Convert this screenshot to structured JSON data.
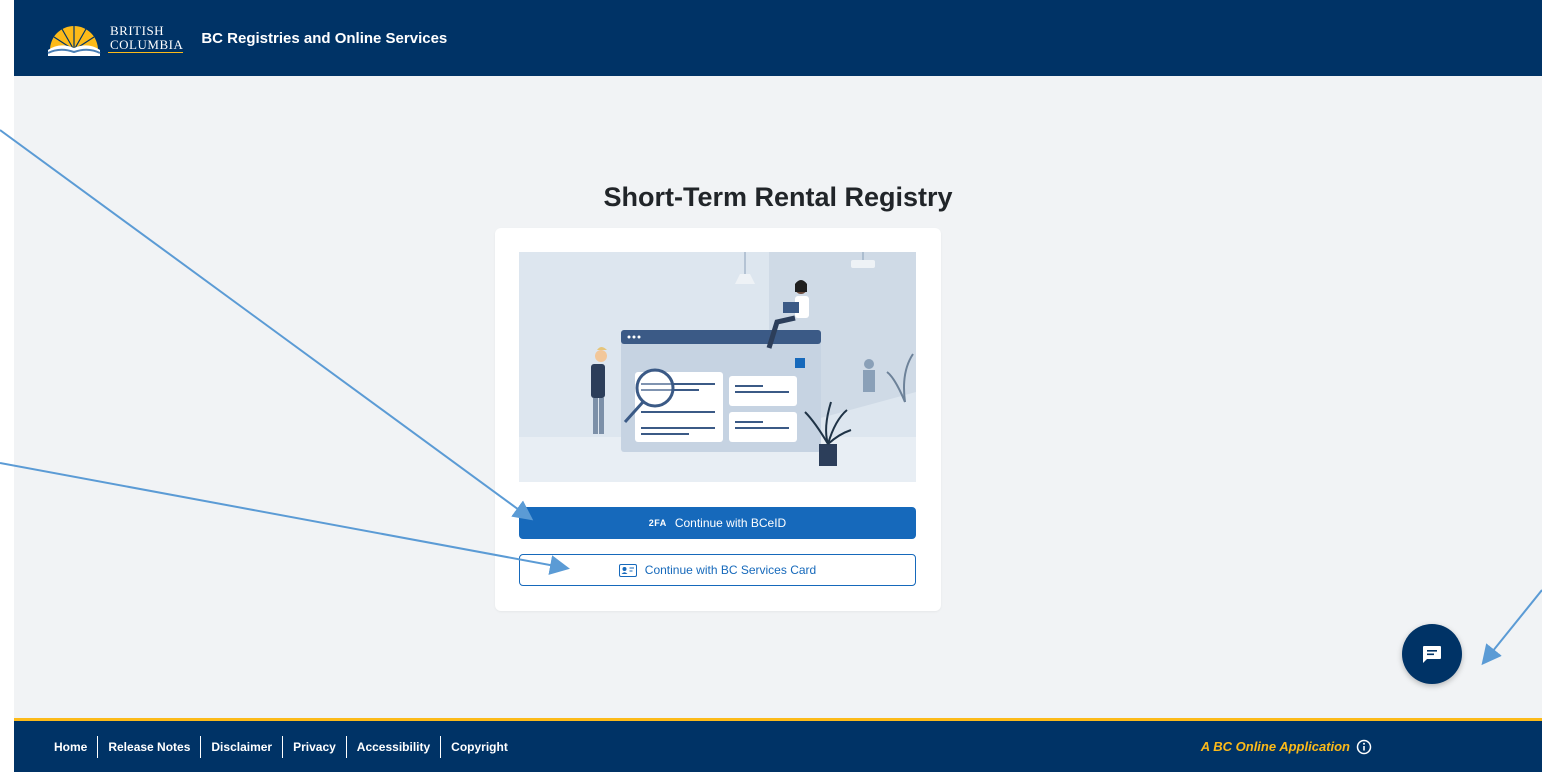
{
  "header": {
    "logo_line1": "BRITISH",
    "logo_line2": "COLUMBIA",
    "app_title": "BC Registries and Online Services"
  },
  "main": {
    "title": "Short-Term Rental Registry",
    "hero_icon": "illustration-people-at-computer",
    "buttons": {
      "bceid_badge": "2FA",
      "bceid_label": "Continue with BCeID",
      "bcsc_label": "Continue with BC Services Card",
      "bcsc_icon": "id-card-icon"
    }
  },
  "chat": {
    "icon": "chat-icon"
  },
  "footer": {
    "links": [
      "Home",
      "Release Notes",
      "Disclaimer",
      "Privacy",
      "Accessibility",
      "Copyright"
    ],
    "app_label": "A BC Online Application",
    "info_icon": "info-icon"
  },
  "colors": {
    "brand_blue": "#003366",
    "accent_gold": "#fcba19",
    "primary": "#1669bb",
    "arrow": "#5b9bd5",
    "background": "#f1f3f5"
  }
}
